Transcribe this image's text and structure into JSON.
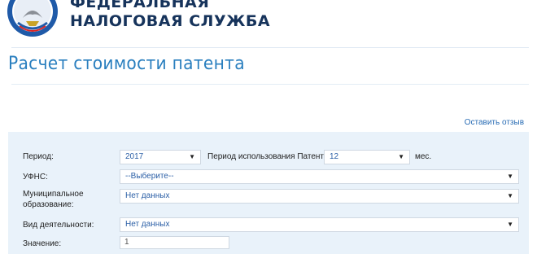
{
  "header": {
    "org_line1": "ФЕДЕРАЛЬНАЯ",
    "org_line2": "НАЛОГОВАЯ СЛУЖБА"
  },
  "page_title": "Расчет стоимости патента",
  "feedback_link": "Оставить отзыв",
  "form": {
    "period_label": "Период:",
    "period_value": "2017",
    "usage_label": "Период использования Патента:",
    "usage_value": "12",
    "usage_unit": "мес.",
    "ufns_label": "УФНС:",
    "ufns_value": "--Выберите--",
    "municipal_label_line1": "Муниципальное",
    "municipal_label_line2": "образование:",
    "municipal_value": "Нет данных",
    "activity_label": "Вид деятельности:",
    "activity_value": "Нет данных",
    "value_label": "Значение:",
    "value_value": "1"
  },
  "colors": {
    "title": "#2a7fbf",
    "org_name": "#16335b",
    "panel_bg": "#e9f2fa",
    "link": "#2a6db5"
  },
  "icons": {
    "logo": "fns-emblem-logo",
    "dropdown": "chevron-down-icon"
  }
}
